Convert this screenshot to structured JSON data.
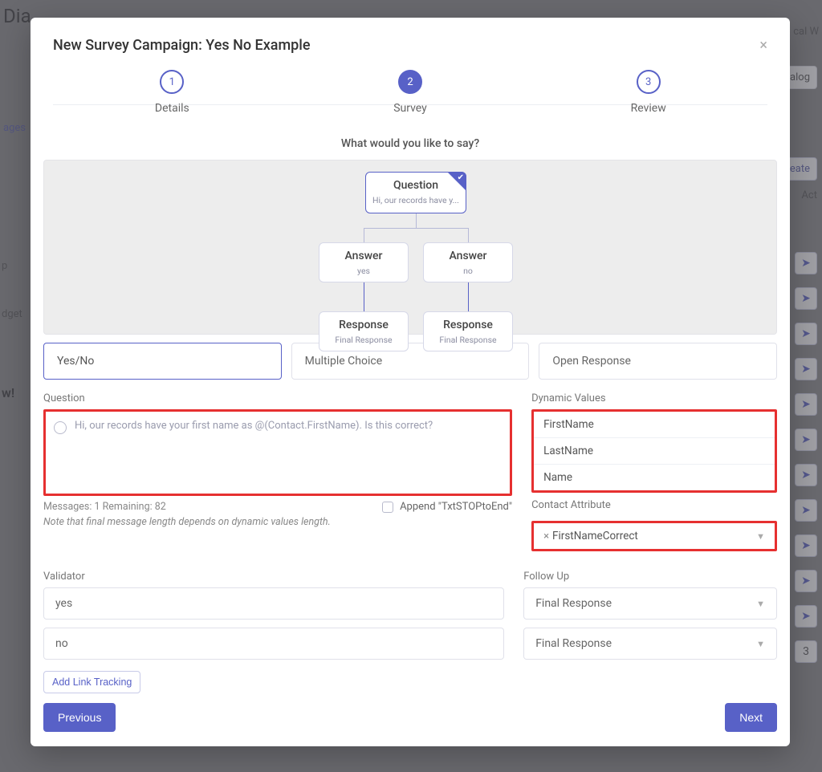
{
  "bg": {
    "title_snip": "Dia",
    "pages": "ages",
    "dialog": "Dialog",
    "create": "Create",
    "act": "Act",
    "right_snip": "cal W",
    "dget": "dget",
    "p": "p",
    "w": "w!",
    "row_num": "3"
  },
  "modal": {
    "title": "New Survey Campaign: Yes No Example",
    "steps": [
      {
        "num": "1",
        "label": "Details"
      },
      {
        "num": "2",
        "label": "Survey"
      },
      {
        "num": "3",
        "label": "Review"
      }
    ],
    "prompt": "What would you like to say?",
    "nodes": {
      "question": {
        "title": "Question",
        "sub": "Hi, our records have y..."
      },
      "answer1": {
        "title": "Answer",
        "sub": "yes"
      },
      "answer2": {
        "title": "Answer",
        "sub": "no"
      },
      "response1": {
        "title": "Response",
        "sub": "Final Response"
      },
      "response2": {
        "title": "Response",
        "sub": "Final Response"
      }
    },
    "types": {
      "yesno": "Yes/No",
      "multiple": "Multiple Choice",
      "open": "Open Response"
    },
    "labels": {
      "question": "Question",
      "dynamic": "Dynamic Values",
      "contact_attr": "Contact Attribute",
      "validator": "Validator",
      "followup": "Follow Up"
    },
    "question_text": "Hi, our records have your first name as @(Contact.FirstName). Is this correct?",
    "meta": "Messages: 1 Remaining: 82",
    "meta_note": "Note that final message length depends on dynamic values length.",
    "append_stop": "Append \"TxtSTOPtoEnd\"",
    "dynamic": [
      "FirstName",
      "LastName",
      "Name"
    ],
    "contact_attr": {
      "value": "FirstNameCorrect"
    },
    "validators": [
      "yes",
      "no"
    ],
    "followups": [
      "Final Response",
      "Final Response"
    ],
    "link_tracking": "Add Link Tracking",
    "buttons": {
      "prev": "Previous",
      "next": "Next"
    }
  }
}
